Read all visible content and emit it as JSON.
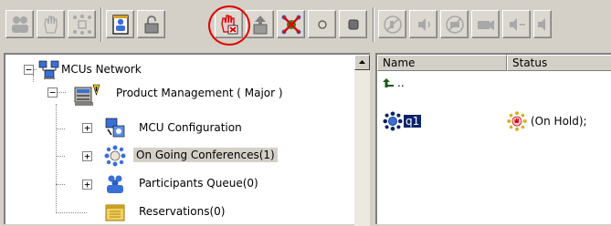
{
  "toolbar": {
    "buttons": [
      {
        "icon": "participants-icon",
        "state": "disabled"
      },
      {
        "icon": "hand-icon",
        "state": "disabled"
      },
      {
        "icon": "network-icon",
        "state": "disabled"
      },
      {
        "icon": "person-card-icon",
        "state": "enabled"
      },
      {
        "icon": "lock-icon",
        "state": "enabled"
      },
      {
        "icon": "hold-hand-icon",
        "state": "enabled",
        "highlighted": true
      },
      {
        "icon": "move-up-icon",
        "state": "enabled"
      },
      {
        "icon": "disconnect-network-icon",
        "state": "enabled"
      },
      {
        "icon": "circle-icon",
        "state": "enabled"
      },
      {
        "icon": "square-icon",
        "state": "enabled"
      },
      {
        "icon": "mute-icon",
        "state": "disabled"
      },
      {
        "icon": "speaker-icon",
        "state": "disabled"
      },
      {
        "icon": "no-video-icon",
        "state": "disabled"
      },
      {
        "icon": "camera-icon",
        "state": "disabled"
      },
      {
        "icon": "volume-left-icon",
        "state": "disabled"
      }
    ],
    "highlight_color": "#e00000"
  },
  "tree": {
    "root": {
      "label": "MCUs Network",
      "expander": "−"
    },
    "mcu": {
      "label": "Product Management  ( Major )",
      "expander": "−"
    },
    "items": [
      {
        "label": "MCU Configuration",
        "expander": "+"
      },
      {
        "label": "On Going Conferences(1)",
        "expander": "+",
        "selected": true
      },
      {
        "label": "Participants Queue(0)",
        "expander": "+"
      },
      {
        "label": "Reservations(0)",
        "expander": ""
      }
    ]
  },
  "list": {
    "columns": [
      "Name",
      "Status"
    ],
    "up_label": "..",
    "rows": [
      {
        "name": "q1",
        "status": "(On Hold);"
      }
    ]
  },
  "colors": {
    "panel_bg": "#d4d0c8",
    "selection": "#0a246a",
    "accent_red": "#e00000"
  }
}
